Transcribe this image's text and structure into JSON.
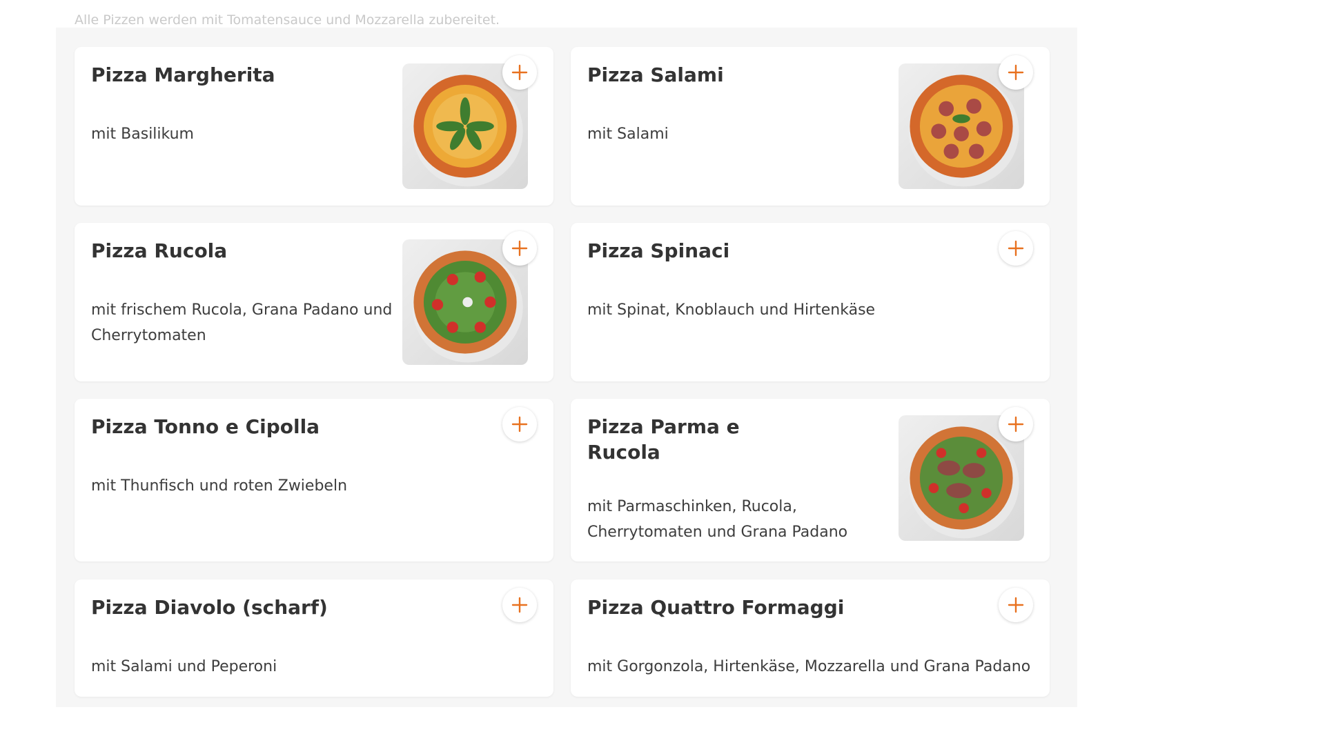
{
  "menu": {
    "intro_note": "Alle Pizzen werden mit Tomatensauce und Mozzarella zubereitet.",
    "accent_color": "#e8711f",
    "add_icon": "plus-icon",
    "items": [
      {
        "title": "Pizza Margherita",
        "description": "mit Basilikum"
      },
      {
        "title": "Pizza Salami",
        "description": "mit Salami"
      },
      {
        "title": "Pizza Rucola",
        "description": "mit frischem Rucola, Grana Padano und Cherrytomaten"
      },
      {
        "title": "Pizza Spinaci",
        "description": "mit Spinat, Knoblauch und Hirtenkäse"
      },
      {
        "title": "Pizza Tonno e Cipolla",
        "description": "mit Thunfisch und roten Zwiebeln"
      },
      {
        "title": "Pizza Parma e Rucola",
        "description": "mit Parmaschinken, Rucola, Cherrytomaten und Grana Padano"
      },
      {
        "title": "Pizza Diavolo (scharf)",
        "description": "mit Salami und Peperoni"
      },
      {
        "title": "Pizza Quattro Formaggi",
        "description": "mit Gorgonzola, Hirtenkäse, Mozzarella und Grana Padano"
      }
    ]
  }
}
